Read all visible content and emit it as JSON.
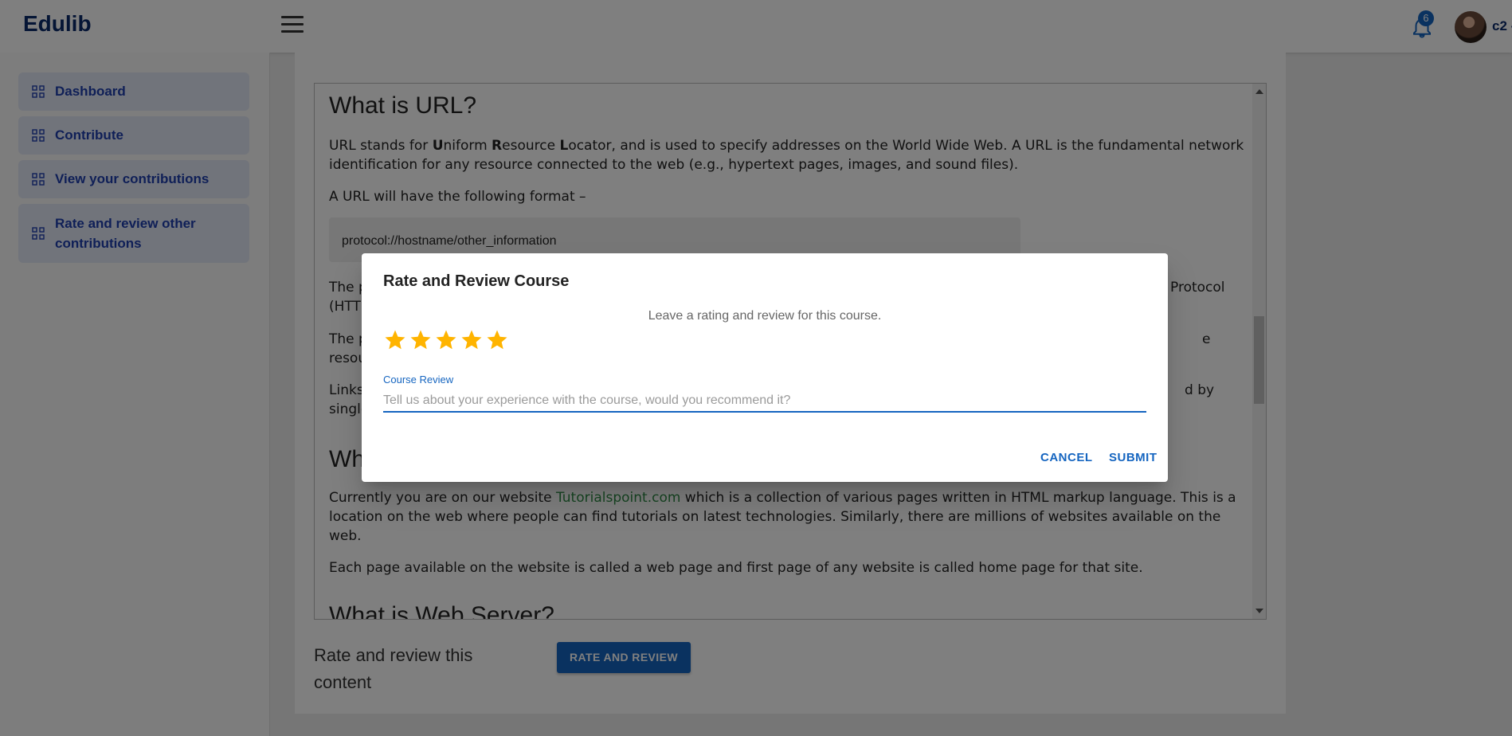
{
  "header": {
    "brand": "Edulib",
    "notification_count": "6",
    "user_label": "c2 -"
  },
  "sidebar": {
    "items": [
      {
        "label": "Dashboard"
      },
      {
        "label": "Contribute"
      },
      {
        "label": "View your contributions"
      },
      {
        "label": "Rate and review other"
      },
      {
        "label": "contributions"
      }
    ]
  },
  "content": {
    "heading_url": "What is URL?",
    "p1_a": "URL stands for ",
    "p1_U": "U",
    "p1_b": "niform ",
    "p1_R": "R",
    "p1_c": "esource ",
    "p1_L": "L",
    "p1_d": "ocator, and is used to specify addresses on the World Wide Web. A URL is the fundamental network identification for any resource connected to the web (e.g., hypertext pages, images, and sound files).",
    "p2": "A URL will have the following format –",
    "code": "protocol://hostname/other_information",
    "p3_start": "The p",
    "p3_end": "Protocol",
    "p3_line2": "(HTT",
    "p4_start": "The p",
    "p4_end": "e",
    "p4_line2": "resou",
    "p5_start": "Links",
    "p5_end": "d by",
    "p5_line2": "single",
    "heading_web_partial": "Wh",
    "p6_a": "Currently you are on our website ",
    "p6_link": "Tutorialspoint.com",
    "p6_b": " which is a collection of various pages written in HTML markup language. This is a location on the web where people can find tutorials on latest technologies. Similarly, there are millions of websites available on the web.",
    "p7": "Each page available on the website is called a web page and first page of any website is called home page for that site.",
    "heading_server_partial": "What is Web Server?"
  },
  "footer_card": {
    "rate_label": "Rate and review this content",
    "rate_button": "RATE AND REVIEW"
  },
  "dialog": {
    "title": "Rate and Review Course",
    "subtitle": "Leave a rating and review for this course.",
    "rating": 5,
    "rating_max": 5,
    "star_color": "#ffb400",
    "field_label": "Course Review",
    "field_placeholder": "Tell us about your experience with the course, would you recommend it?",
    "field_value": "",
    "cancel_label": "CANCEL",
    "submit_label": "SUBMIT"
  }
}
